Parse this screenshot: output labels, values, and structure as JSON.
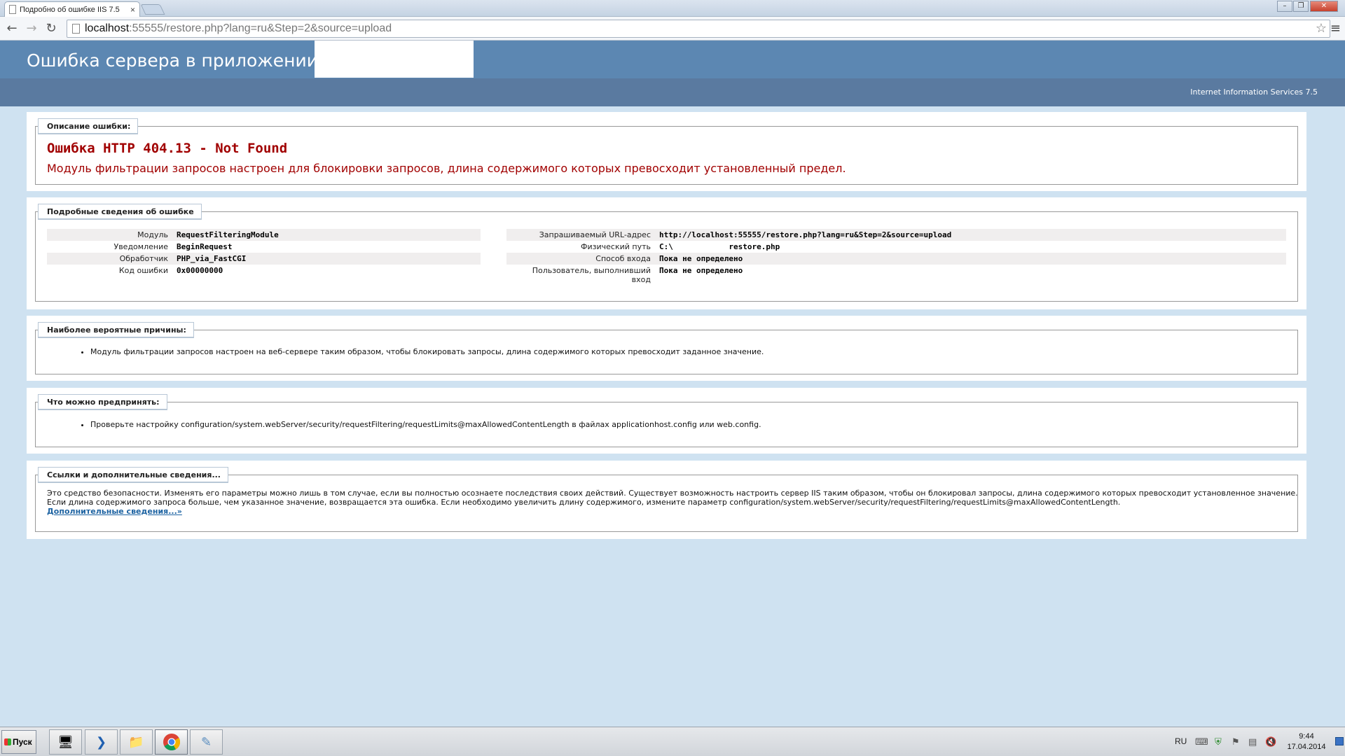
{
  "browser": {
    "tab_title": "Подробно об ошибке IIS 7.5",
    "tab_close": "×",
    "url_host": "localhost",
    "url_rest": ":55555/restore.php?lang=ru&Step=2&source=upload",
    "back_glyph": "←",
    "forward_glyph": "→",
    "reload_glyph": "↻",
    "star_glyph": "☆",
    "menu_glyph": "≡",
    "min_glyph": "–",
    "restore_glyph": "❐",
    "close_glyph": "✕",
    "icons": [
      "page-icon",
      "back-arrow-icon",
      "forward-arrow-icon",
      "reload-icon",
      "star-icon",
      "menu-icon"
    ]
  },
  "iis": {
    "header_title": "Ошибка сервера в приложении",
    "version": "Internet Information Services 7.5",
    "colors": {
      "header": "#5c87b2",
      "subheader": "#5a7aa0",
      "background": "#cfe2f1",
      "error": "#a10000",
      "link": "#1d63a2"
    },
    "summary": {
      "legend": "Описание ошибки:",
      "code": "Ошибка HTTP 404.13 - Not Found",
      "message": "Модуль фильтрации запросов настроен для блокировки запросов, длина содержимого которых превосходит установленный предел."
    },
    "details": {
      "legend": "Подробные сведения об ошибке",
      "left": [
        {
          "label": "Модуль",
          "value": "RequestFilteringModule"
        },
        {
          "label": "Уведомление",
          "value": "BeginRequest"
        },
        {
          "label": "Обработчик",
          "value": "PHP_via_FastCGI"
        },
        {
          "label": "Код ошибки",
          "value": "0x00000000"
        }
      ],
      "right": [
        {
          "label": "Запрашиваемый URL-адрес",
          "value": "http://localhost:55555/restore.php?lang=ru&Step=2&source=upload"
        },
        {
          "label": "Физический путь",
          "value": "C:\\            restore.php"
        },
        {
          "label": "Способ входа",
          "value": "Пока не определено"
        },
        {
          "label": "Пользователь, выполнивший вход",
          "value": "Пока не определено"
        }
      ]
    },
    "causes": {
      "legend": "Наиболее вероятные причины:",
      "items": [
        "Модуль фильтрации запросов настроен на веб-сервере таким образом, чтобы блокировать запросы, длина содержимого которых превосходит заданное значение."
      ]
    },
    "actions": {
      "legend": "Что можно предпринять:",
      "items": [
        "Проверьте настройку configuration/system.webServer/security/requestFiltering/requestLimits@maxAllowedContentLength в файлах applicationhost.config или web.config."
      ]
    },
    "links": {
      "legend": "Ссылки и дополнительные сведения...",
      "text": "Это средство безопасности. Изменять его параметры можно лишь в том случае, если вы полностью осознаете последствия своих действий. Существует возможность настроить сервер IIS таким образом, чтобы он блокировал запросы, длина содержимого которых превосходит установленное значение. Если длина содержимого запроса больше, чем указанное значение, возвращается эта ошибка. Если необходимо увеличить длину содержимого, измените параметр configuration/system.webServer/security/requestFiltering/requestLimits@maxAllowedContentLength.",
      "more_link": "Дополнительные сведения...»"
    }
  },
  "taskbar": {
    "start_label": "Пуск",
    "language": "RU",
    "time": "9:44",
    "date": "17.04.2014",
    "apps": [
      "server-manager-icon",
      "powershell-icon",
      "explorer-folder-icon",
      "chrome-icon",
      "notepad-icon"
    ],
    "tray_icons": [
      "keyboard-icon",
      "security-shield-icon",
      "flag-icon",
      "network-icon",
      "volume-muted-icon"
    ]
  }
}
